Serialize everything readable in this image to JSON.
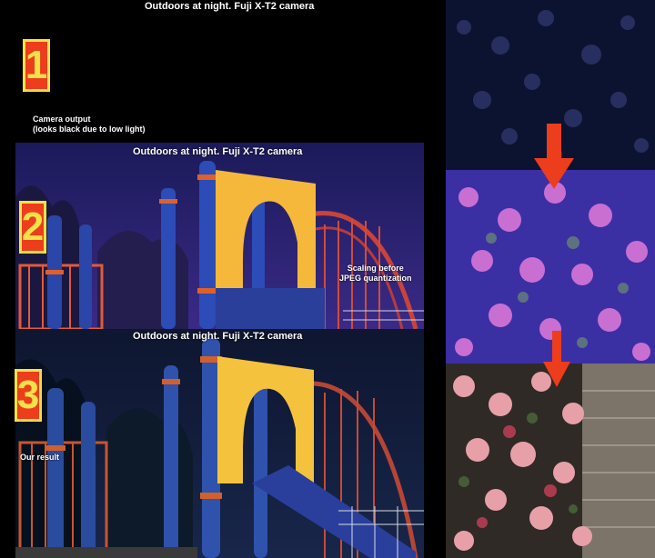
{
  "panels": {
    "p1": {
      "title": "Outdoors at night. Fuji X-T2 camera",
      "badge": "1",
      "caption_line1": "Camera output",
      "caption_line2": "(looks black due to low light)"
    },
    "p2": {
      "title": "Outdoors at night. Fuji X-T2 camera",
      "badge": "2",
      "caption_line1": "Scaling before",
      "caption_line2": "JPEG quantization"
    },
    "p3": {
      "title": "Outdoors at night. Fuji X-T2 camera",
      "badge": "3",
      "caption": "Our result"
    }
  },
  "colors": {
    "badge_fill": "#ec3d1c",
    "badge_text": "#f3e14a",
    "arrow": "#ec3d1c"
  }
}
